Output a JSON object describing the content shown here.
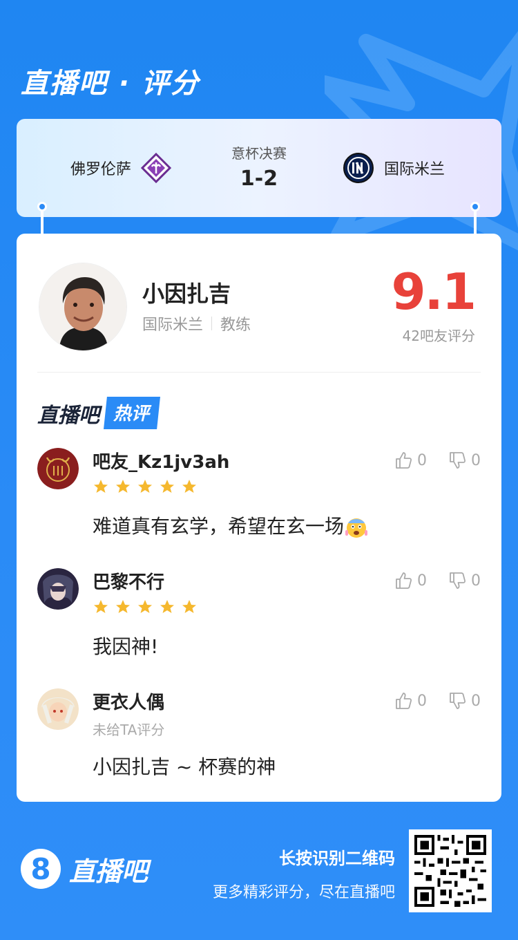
{
  "brand": {
    "title": "直播吧 · 评分"
  },
  "match": {
    "home_team": "佛罗伦萨",
    "away_team": "国际米兰",
    "competition": "意杯决赛",
    "score": "1-2"
  },
  "subject": {
    "name": "小因扎吉",
    "team": "国际米兰",
    "role": "教练",
    "rating": "9.1",
    "rating_count": "42吧友评分"
  },
  "hot": {
    "brand": "直播吧",
    "tag": "热评"
  },
  "comments": [
    {
      "user": "吧友_Kz1jv3ah",
      "stars": 5,
      "text": "难道真有玄学，希望在玄一场",
      "likes": "0",
      "dislikes": "0"
    },
    {
      "user": "巴黎不行",
      "stars": 5,
      "text": "我因神!",
      "likes": "0",
      "dislikes": "0"
    },
    {
      "user": "更衣人偶",
      "sub": "未给TA评分",
      "text": "小因扎吉 ~ 杯赛的神",
      "likes": "0",
      "dislikes": "0"
    }
  ],
  "footer": {
    "logo_digit": "8",
    "logo_name": "直播吧",
    "cta": "长按识别二维码",
    "slogan": "更多精彩评分，尽在直播吧"
  },
  "colors": {
    "accent": "#2a8bf6",
    "rating": "#e8423a",
    "star": "#f5b82e"
  }
}
